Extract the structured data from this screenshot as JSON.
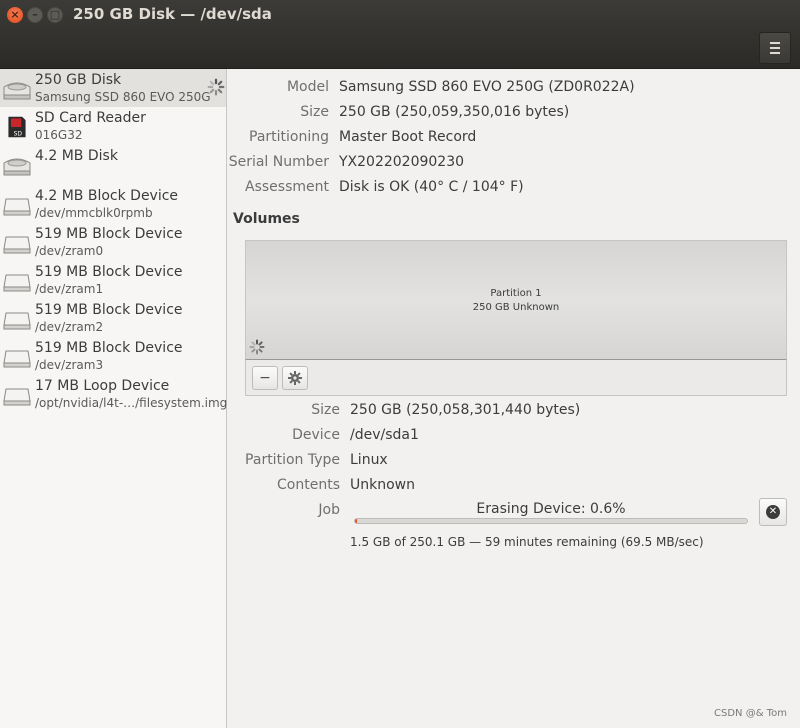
{
  "window": {
    "title": "250 GB Disk — /dev/sda",
    "close_glyph": "×",
    "min_glyph": "–",
    "max_glyph": "□"
  },
  "sidebar": {
    "devices": [
      {
        "name": "250 GB Disk",
        "sub": "Samsung SSD 860 EVO 250G",
        "icon": "hdd-icon"
      },
      {
        "name": "SD Card Reader",
        "sub": "016G32",
        "icon": "sd-card-icon"
      },
      {
        "name": "4.2 MB Disk",
        "sub": "",
        "icon": "hdd-icon"
      },
      {
        "name": "4.2 MB Block Device",
        "sub": "/dev/mmcblk0rpmb",
        "icon": "drive-icon"
      },
      {
        "name": "519 MB Block Device",
        "sub": "/dev/zram0",
        "icon": "drive-icon"
      },
      {
        "name": "519 MB Block Device",
        "sub": "/dev/zram1",
        "icon": "drive-icon"
      },
      {
        "name": "519 MB Block Device",
        "sub": "/dev/zram2",
        "icon": "drive-icon"
      },
      {
        "name": "519 MB Block Device",
        "sub": "/dev/zram3",
        "icon": "drive-icon"
      },
      {
        "name": "17 MB Loop Device",
        "sub": "/opt/nvidia/l4t-…/filesystem.img",
        "icon": "drive-icon"
      }
    ]
  },
  "disk": {
    "model_label": "Model",
    "model": "Samsung SSD 860 EVO 250G (ZD0R022A)",
    "size_label": "Size",
    "size": "250 GB (250,059,350,016 bytes)",
    "partitioning_label": "Partitioning",
    "partitioning": "Master Boot Record",
    "serial_label": "Serial Number",
    "serial": "YX202202090230",
    "assessment_label": "Assessment",
    "assessment": "Disk is OK (40° C / 104° F)"
  },
  "volumes": {
    "heading": "Volumes",
    "partition_name": "Partition 1",
    "partition_desc": "250 GB Unknown",
    "remove_glyph": "−",
    "size_label": "Size",
    "size": "250 GB (250,058,301,440 bytes)",
    "device_label": "Device",
    "device": "/dev/sda1",
    "ptype_label": "Partition Type",
    "ptype": "Linux",
    "contents_label": "Contents",
    "contents": "Unknown",
    "job_label": "Job",
    "job_title": "Erasing Device: 0.6%",
    "job_progress": 0.006,
    "job_detail": "1.5 GB of 250.1 GB — 59 minutes remaining (69.5 MB/sec)",
    "cancel_glyph": "✕"
  },
  "watermark": "CSDN @& Tom",
  "colors": {
    "accent": "#e95420",
    "titlebar": "#3c3b37",
    "close": "#df4a16"
  }
}
